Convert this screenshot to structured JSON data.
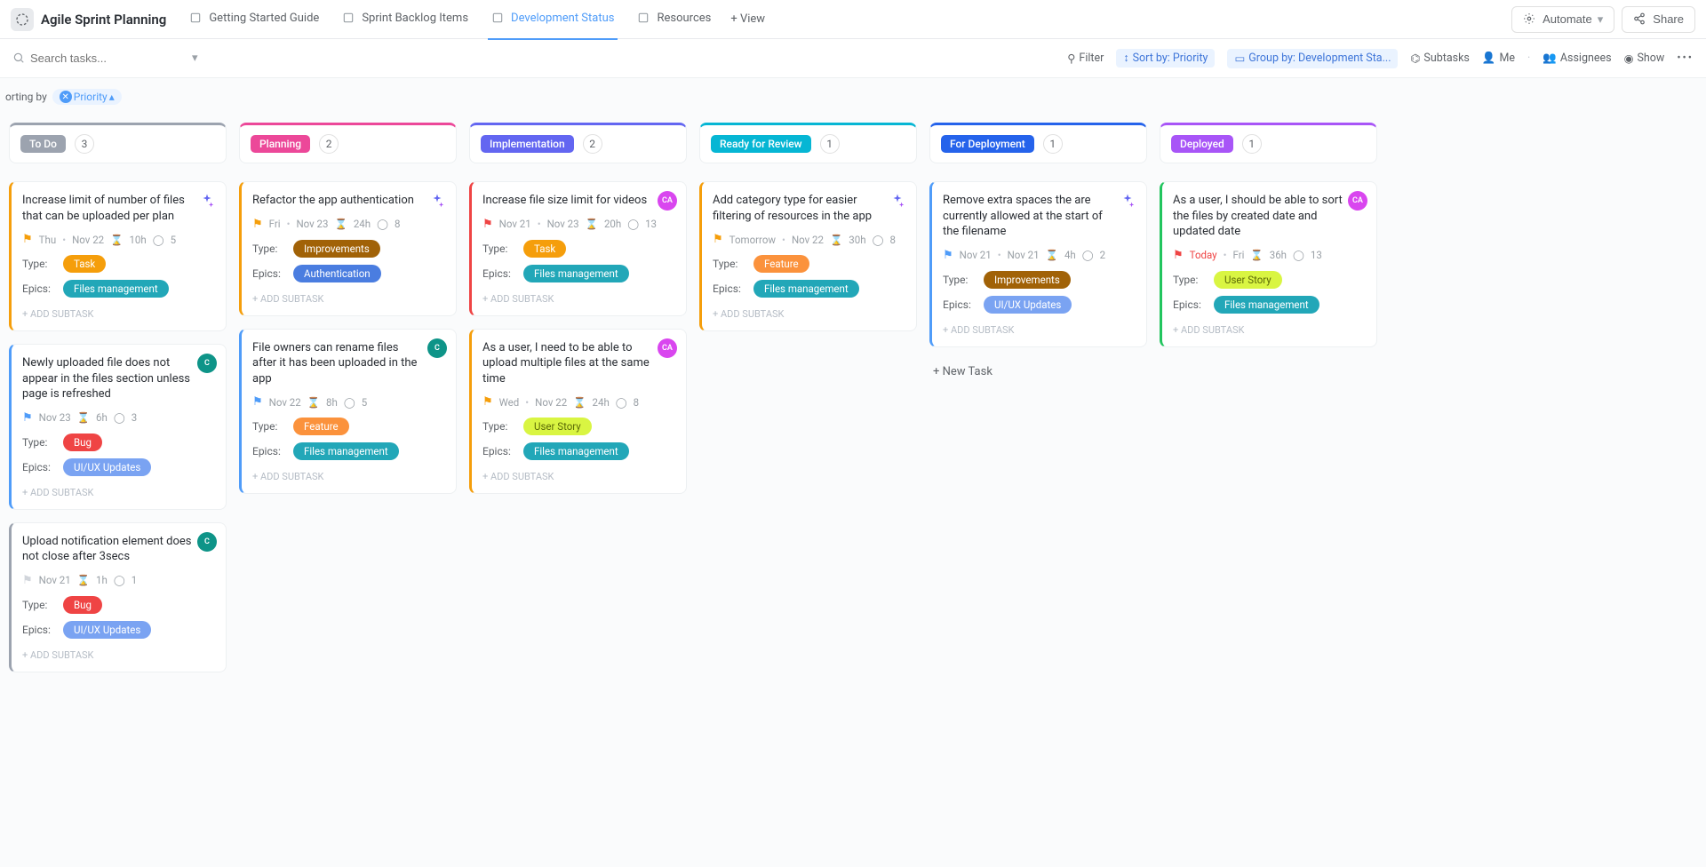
{
  "header": {
    "title": "Agile Sprint Planning",
    "tabs": [
      {
        "label": "Getting Started Guide",
        "active": false
      },
      {
        "label": "Sprint Backlog Items",
        "active": false
      },
      {
        "label": "Development Status",
        "active": true
      },
      {
        "label": "Resources",
        "active": false
      }
    ],
    "add_view": "+ View",
    "automate": "Automate",
    "share": "Share"
  },
  "toolbar": {
    "search_placeholder": "Search tasks...",
    "filter": "Filter",
    "sort": "Sort by: Priority",
    "group": "Group by: Development Sta...",
    "subtasks": "Subtasks",
    "me": "Me",
    "assignees": "Assignees",
    "show": "Show"
  },
  "sorting": {
    "label": "orting by",
    "pill": "Priority"
  },
  "columns": [
    {
      "key": "todo",
      "label": "To Do",
      "count": "3",
      "color": "#9ca3af"
    },
    {
      "key": "planning",
      "label": "Planning",
      "count": "2",
      "color": "#ec4899"
    },
    {
      "key": "implementation",
      "label": "Implementation",
      "count": "2",
      "color": "#6366f1"
    },
    {
      "key": "ready",
      "label": "Ready for Review",
      "count": "1",
      "color": "#06b6d4"
    },
    {
      "key": "deploy",
      "label": "For Deployment",
      "count": "1",
      "color": "#2563eb"
    },
    {
      "key": "deployed",
      "label": "Deployed",
      "count": "1",
      "color": "#a855f7"
    }
  ],
  "labels": {
    "type": "Type:",
    "epics": "Epics:",
    "add_subtask": "+ ADD SUBTASK",
    "new_task": "+ New Task"
  },
  "tags": {
    "task": {
      "text": "Task",
      "bg": "#f59e0b"
    },
    "bug": {
      "text": "Bug",
      "bg": "#ef4444"
    },
    "feature": {
      "text": "Feature",
      "bg": "#fb923c"
    },
    "improvements": {
      "text": "Improvements",
      "bg": "#a16207"
    },
    "userstory": {
      "text": "User Story",
      "bg": "#d9f542",
      "fg": "#5c6b07"
    },
    "files": {
      "text": "Files management",
      "bg": "#22a7b8"
    },
    "uiux": {
      "text": "UI/UX Updates",
      "bg": "#7aa3f2"
    },
    "auth": {
      "text": "Authentication",
      "bg": "#4a7de0"
    }
  },
  "cards": {
    "todo": [
      {
        "title": "Increase limit of number of files that can be uploaded per plan",
        "avatar": "sparkle",
        "flag": "#f59e0b",
        "dates": "Thu",
        "due": "Nov 22",
        "est": "10h",
        "cnt": "5",
        "type": "task",
        "epic": "files",
        "stripe": "#f59e0b"
      },
      {
        "title": "Newly uploaded file does not appear in the files section unless page is refreshed",
        "avatar": "teal",
        "avinit": "C",
        "flag": "#4f9cf9",
        "dates": "Nov 23",
        "est": "6h",
        "cnt": "3",
        "type": "bug",
        "epic": "uiux",
        "stripe": "#4f9cf9"
      },
      {
        "title": "Upload notification element does not close after 3secs",
        "avatar": "teal",
        "avinit": "C",
        "flag": "#d1d5db",
        "dates": "Nov 21",
        "est": "1h",
        "cnt": "1",
        "type": "bug",
        "epic": "uiux",
        "stripe": "#9ca3af"
      }
    ],
    "planning": [
      {
        "title": "Refactor the app authentication",
        "avatar": "sparkle",
        "flag": "#f59e0b",
        "dates": "Fri",
        "due": "Nov 23",
        "est": "24h",
        "cnt": "8",
        "type": "improvements",
        "epic": "auth",
        "stripe": "#f59e0b"
      },
      {
        "title": "File owners can rename files after it has been uploaded in the app",
        "avatar": "teal",
        "avinit": "C",
        "flag": "#4f9cf9",
        "dates": "Nov 22",
        "est": "8h",
        "cnt": "5",
        "type": "feature",
        "epic": "files",
        "stripe": "#4f9cf9"
      }
    ],
    "implementation": [
      {
        "title": "Increase file size limit for videos",
        "avatar": "pink",
        "avinit": "CA",
        "flag": "#ef4444",
        "dates": "Nov 21",
        "due": "Nov 23",
        "est": "20h",
        "cnt": "13",
        "type": "task",
        "epic": "files",
        "stripe": "#ef4444"
      },
      {
        "title": "As a user, I need to be able to upload multiple files at the same time",
        "avatar": "pink",
        "avinit": "CA",
        "flag": "#f59e0b",
        "dates": "Wed",
        "due": "Nov 22",
        "est": "24h",
        "cnt": "8",
        "type": "userstory",
        "epic": "files",
        "stripe": "#f59e0b"
      }
    ],
    "ready": [
      {
        "title": "Add category type for easier filtering of resources in the app",
        "avatar": "sparkle",
        "flag": "#f59e0b",
        "dates": "Tomorrow",
        "due": "Nov 22",
        "est": "30h",
        "cnt": "8",
        "type": "feature",
        "epic": "files",
        "stripe": "#f59e0b"
      }
    ],
    "deploy": [
      {
        "title": "Remove extra spaces the are currently allowed at the start of the filename",
        "avatar": "sparkle",
        "flag": "#4f9cf9",
        "dates": "Nov 21",
        "due": "Nov 21",
        "est": "4h",
        "cnt": "2",
        "type": "improvements",
        "epic": "uiux",
        "stripe": "#4f9cf9"
      }
    ],
    "deployed": [
      {
        "title": "As a user, I should be able to sort the files by created date and updated date",
        "avatar": "pink",
        "avinit": "CA",
        "flag": "#ef4444",
        "dates": "Today",
        "due": "Fri",
        "est": "36h",
        "cnt": "13",
        "type": "userstory",
        "epic": "files",
        "stripe": "#22c55e",
        "datesColor": "#ef4444"
      }
    ]
  }
}
